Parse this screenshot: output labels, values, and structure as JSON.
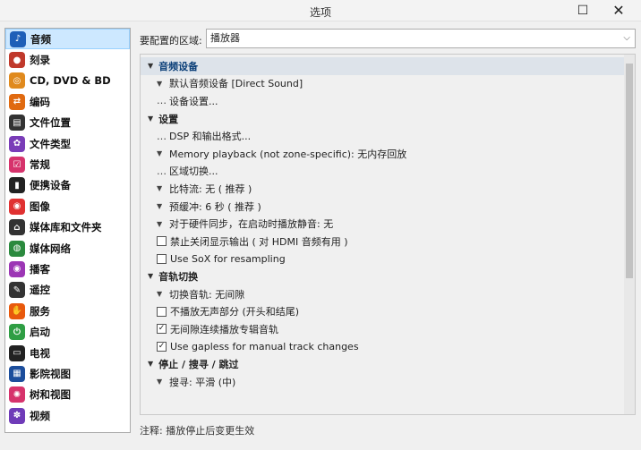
{
  "window": {
    "title": "选项",
    "maximize_glyph": "☐",
    "close_glyph": "✕"
  },
  "sidebar": {
    "items": [
      {
        "label": "音频",
        "icon": "music-note-icon",
        "glyph": "♪",
        "color": "#1e5fb8",
        "selected": true
      },
      {
        "label": "刻录",
        "icon": "burn-icon",
        "glyph": "●",
        "color": "#c0392b"
      },
      {
        "label": "CD, DVD & BD",
        "icon": "disc-icon",
        "glyph": "◎",
        "color": "#e08a1e"
      },
      {
        "label": "编码",
        "icon": "encode-icon",
        "glyph": "⇄",
        "color": "#e06a10"
      },
      {
        "label": "文件位置",
        "icon": "file-location-icon",
        "glyph": "▤",
        "color": "#333333"
      },
      {
        "label": "文件类型",
        "icon": "file-type-icon",
        "glyph": "✿",
        "color": "#7a3db8"
      },
      {
        "label": "常规",
        "icon": "general-icon",
        "glyph": "☑",
        "color": "#d6336c"
      },
      {
        "label": "便携设备",
        "icon": "portable-device-icon",
        "glyph": "▮",
        "color": "#222222"
      },
      {
        "label": "图像",
        "icon": "image-icon",
        "glyph": "◉",
        "color": "#e03131"
      },
      {
        "label": "媒体库和文件夹",
        "icon": "library-icon",
        "glyph": "⌂",
        "color": "#333333"
      },
      {
        "label": "媒体网络",
        "icon": "media-network-icon",
        "glyph": "◍",
        "color": "#2b8a3e"
      },
      {
        "label": "播客",
        "icon": "podcast-icon",
        "glyph": "◉",
        "color": "#9c36b5"
      },
      {
        "label": "遥控",
        "icon": "remote-icon",
        "glyph": "✎",
        "color": "#333333"
      },
      {
        "label": "服务",
        "icon": "services-icon",
        "glyph": "✋",
        "color": "#e8590c"
      },
      {
        "label": "启动",
        "icon": "startup-icon",
        "glyph": "⏻",
        "color": "#2f9e44"
      },
      {
        "label": "电视",
        "icon": "tv-icon",
        "glyph": "▭",
        "color": "#222222"
      },
      {
        "label": "影院视图",
        "icon": "theater-view-icon",
        "glyph": "▦",
        "color": "#1c4e9c"
      },
      {
        "label": "树和视图",
        "icon": "tree-view-icon",
        "glyph": "✺",
        "color": "#d6336c"
      },
      {
        "label": "视频",
        "icon": "video-icon",
        "glyph": "✽",
        "color": "#6f3bb8"
      }
    ]
  },
  "zone": {
    "label": "要配置的区域:",
    "value": "播放器",
    "arrow": "⌵"
  },
  "settings": [
    {
      "type": "header",
      "label": "音频设备",
      "highlight": true
    },
    {
      "type": "item",
      "marker": "▼",
      "label": "默认音频设备 [Direct Sound]"
    },
    {
      "type": "item",
      "marker": "…",
      "label": "设备设置..."
    },
    {
      "type": "header",
      "label": "设置"
    },
    {
      "type": "item",
      "marker": "…",
      "label": "DSP 和输出格式..."
    },
    {
      "type": "item",
      "marker": "▼",
      "label": "Memory playback (not zone-specific): 无内存回放"
    },
    {
      "type": "item",
      "marker": "…",
      "label": "区域切换..."
    },
    {
      "type": "item",
      "marker": "▼",
      "label": "比特流: 无 ( 推荐 )"
    },
    {
      "type": "item",
      "marker": "▼",
      "label": "预缓冲: 6 秒 ( 推荐 )"
    },
    {
      "type": "item",
      "marker": "▼",
      "label": "对于硬件同步，在启动时播放静音: 无"
    },
    {
      "type": "check",
      "checked": false,
      "label": "禁止关闭显示输出 ( 对 HDMI 音频有用 )"
    },
    {
      "type": "check",
      "checked": false,
      "label": "Use SoX for resampling"
    },
    {
      "type": "header",
      "label": "音轨切换"
    },
    {
      "type": "item",
      "marker": "▼",
      "label": "切换音轨: 无间隙"
    },
    {
      "type": "check",
      "checked": false,
      "label": "不播放无声部分 (开头和结尾)"
    },
    {
      "type": "check",
      "checked": true,
      "label": "无间隙连续播放专辑音轨"
    },
    {
      "type": "check",
      "checked": true,
      "label": "Use gapless for manual track changes"
    },
    {
      "type": "header",
      "label": "停止 / 搜寻 / 跳过"
    },
    {
      "type": "item",
      "marker": "▼",
      "label": "搜寻: 平滑 (中)"
    }
  ],
  "note": "注释: 播放停止后变更生效"
}
